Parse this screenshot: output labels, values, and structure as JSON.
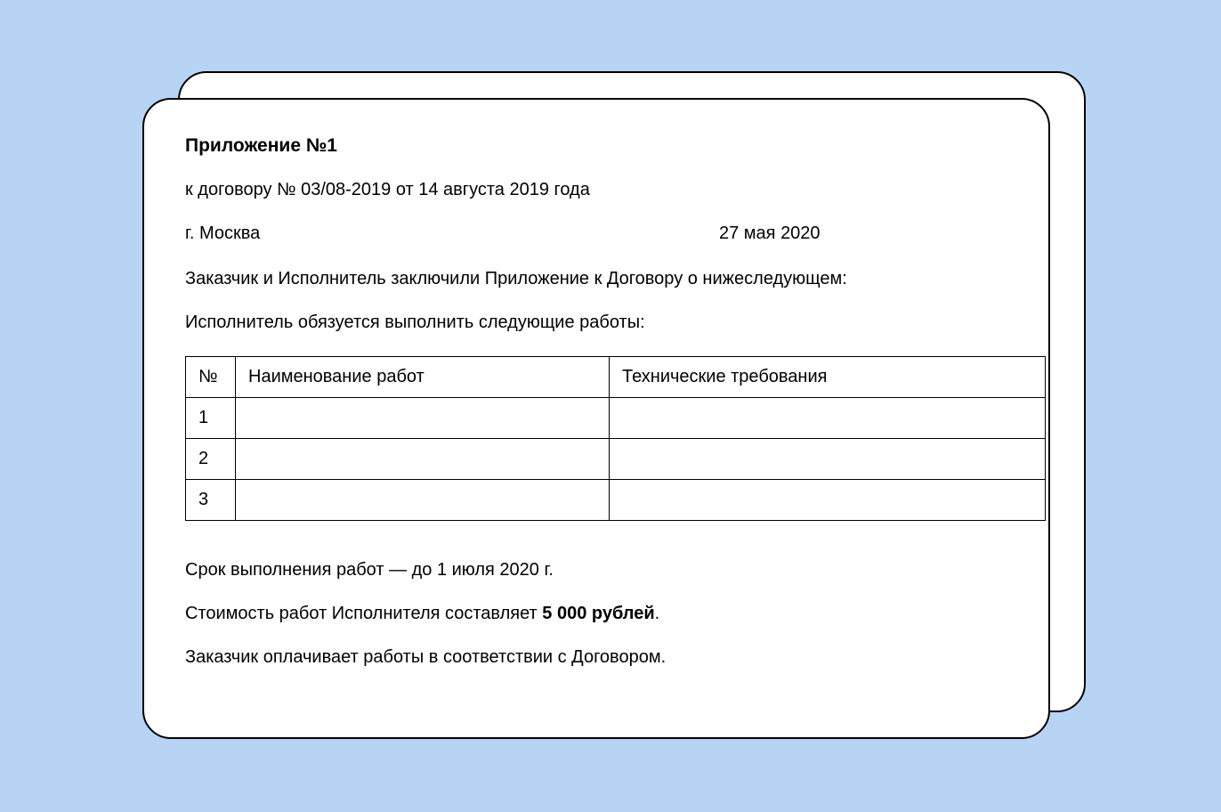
{
  "doc": {
    "title": "Приложение №1",
    "subtitle": "к договору № 03/08-2019 от 14 августа 2019 года",
    "place": "г. Москва",
    "date": "27 мая 2020",
    "intro": "Заказчик и Исполнитель заключили Приложение к Договору о нижеследующем:",
    "obligation": "Исполнитель обязуется выполнить следующие работы:",
    "table": {
      "headers": {
        "num": "№",
        "name": "Наименование работ",
        "req": "Технические требования"
      },
      "rows": [
        {
          "num": "1",
          "name": "",
          "req": ""
        },
        {
          "num": "2",
          "name": "",
          "req": ""
        },
        {
          "num": "3",
          "name": "",
          "req": ""
        }
      ]
    },
    "deadline": "Срок выполнения работ — до 1 июля 2020 г.",
    "price_prefix": "Стоимость работ Исполнителя составляет ",
    "price_value": "5 000 рублей",
    "price_suffix": ".",
    "payment": "Заказчик оплачивает работы в соответствии с Договором."
  }
}
